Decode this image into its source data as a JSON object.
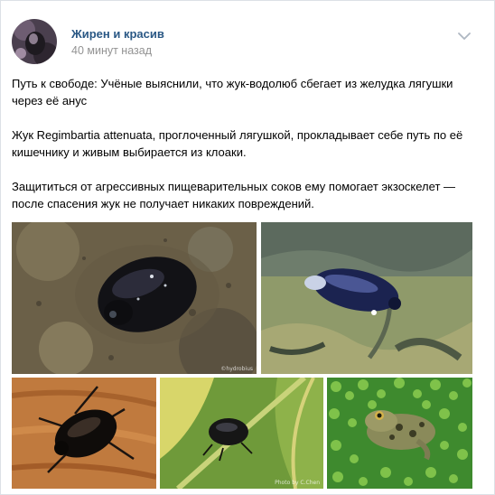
{
  "post": {
    "author": "Жирен и красив",
    "time": "40 минут назад",
    "paragraphs": [
      "Путь к свободе: Учёные выяснили, что жук-водолюб сбегает из желудка лягушки\nчерез её анус",
      "Жук Regimbartia attenuata, проглоченный лягушкой, прокладывает себе путь по её\nкишечнику и живым выбирается из клоаки.",
      "Защититься от агрессивных пищеварительных соков ему помогает экзоскелет —\nпосле спасения жук не получает никаких повреждений."
    ],
    "photos": [
      {
        "subject": "beetle on wet sand",
        "watermark": "©hydrobius"
      },
      {
        "subject": "beetle in water",
        "watermark": ""
      },
      {
        "subject": "beetle on wood",
        "watermark": ""
      },
      {
        "subject": "beetle on leaf",
        "watermark": "Photo by C.Chen"
      },
      {
        "subject": "frog in duckweed",
        "watermark": ""
      }
    ]
  },
  "icons": {
    "menu": "chevron-down-icon",
    "avatar": "avatar"
  },
  "colors": {
    "author_link": "#2a5885",
    "timestamp": "#939393",
    "page_background": "#edeef0"
  }
}
